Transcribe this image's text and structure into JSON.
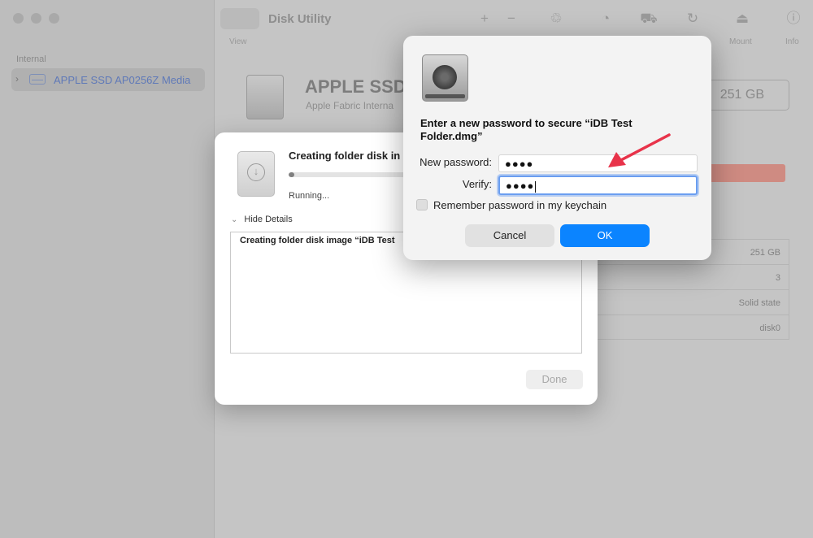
{
  "window": {
    "title": "Disk Utility",
    "view_label": "View",
    "toolbar_labels": {
      "mount": "Mount",
      "info": "Info"
    }
  },
  "sidebar": {
    "section": "Internal",
    "items": [
      {
        "label": "APPLE SSD AP0256Z Media",
        "icon": "internal-disk-icon"
      }
    ]
  },
  "disk": {
    "name": "APPLE SSD",
    "subtitle": "Apple Fabric Interna",
    "capacity": "251 GB",
    "info_values": [
      "251 GB",
      "3",
      "Solid state",
      "disk0"
    ]
  },
  "progress_sheet": {
    "title": "Creating folder disk in",
    "progress_fraction": 0.02,
    "status": "Running...",
    "details_toggle": "Hide Details",
    "log_text": "Creating folder disk image “iDB Test",
    "done_label": "Done"
  },
  "password_dialog": {
    "message": "Enter a new password to secure “iDB Test Folder.dmg”",
    "new_password_label": "New password:",
    "new_password_value": "●●●●",
    "verify_label": "Verify:",
    "verify_value": "●●●●",
    "remember_label": "Remember password in my keychain",
    "remember_checked": false,
    "cancel_label": "Cancel",
    "ok_label": "OK"
  },
  "colors": {
    "accent": "#0b84ff",
    "focus_ring": "#6b9ef0",
    "annotation_arrow": "#e8334a",
    "usage_bar": "#cf8b82"
  }
}
